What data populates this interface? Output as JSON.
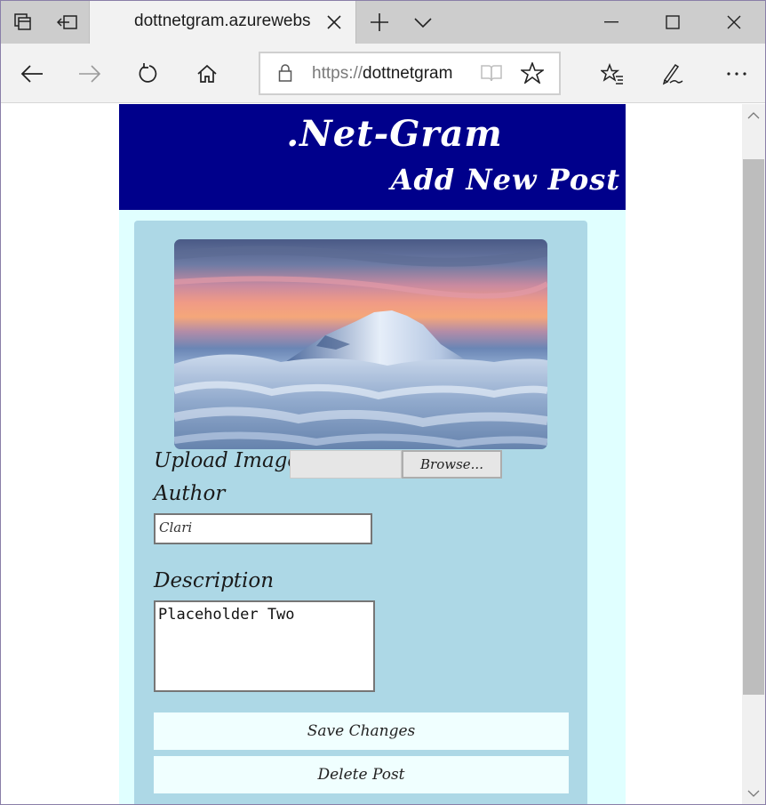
{
  "browser": {
    "tab_title": "dottnetgram.azurewebs",
    "address": {
      "protocol": "https://",
      "host": "dottnetgram"
    },
    "icons": {
      "tab_manager": "tab-manager-icon",
      "set_aside": "set-aside-tabs-icon",
      "new_tab": "plus-icon",
      "tab_list": "chevron-down-icon",
      "back": "arrow-left-icon",
      "forward": "arrow-right-icon",
      "refresh": "refresh-icon",
      "home": "home-icon",
      "lock": "lock-icon",
      "reading_view": "book-icon",
      "favorite": "star-icon",
      "favorites_list": "favorites-list-icon",
      "notes": "pen-icon",
      "more": "more-icon"
    }
  },
  "page": {
    "site_title": ".Net-Gram",
    "heading": "Add New Post",
    "colors": {
      "header_bg": "#00008b",
      "page_bg": "#e0ffff",
      "card_bg": "#add8e6",
      "button_bg": "#f0ffff"
    },
    "image": {
      "subject": "snow-capped mountain above clouds at sunset"
    },
    "form": {
      "upload_label": "Upload Image",
      "browse_label": "Browse...",
      "author_label": "Author",
      "author_value": "Clari",
      "description_label": "Description",
      "description_value": "Placeholder Two",
      "save_label": "Save Changes",
      "delete_label": "Delete Post"
    }
  }
}
